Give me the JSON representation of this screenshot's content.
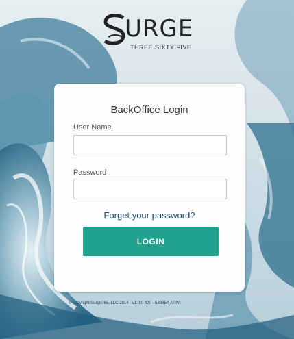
{
  "brand": {
    "name": "URGE",
    "tagline": "THREE SIXTY FIVE"
  },
  "login": {
    "title": "BackOffice Login",
    "username_label": "User Name",
    "username_value": "",
    "password_label": "Password",
    "password_value": "",
    "forgot_link": "Forget your password?",
    "button_label": "LOGIN"
  },
  "footer": {
    "text": "© copyright Surge365, LLC 2014 - v1.0.0.420 - 539654-APPA"
  },
  "colors": {
    "accent": "#21a48f",
    "link": "#1a4a73",
    "background": "#c9dce5"
  }
}
